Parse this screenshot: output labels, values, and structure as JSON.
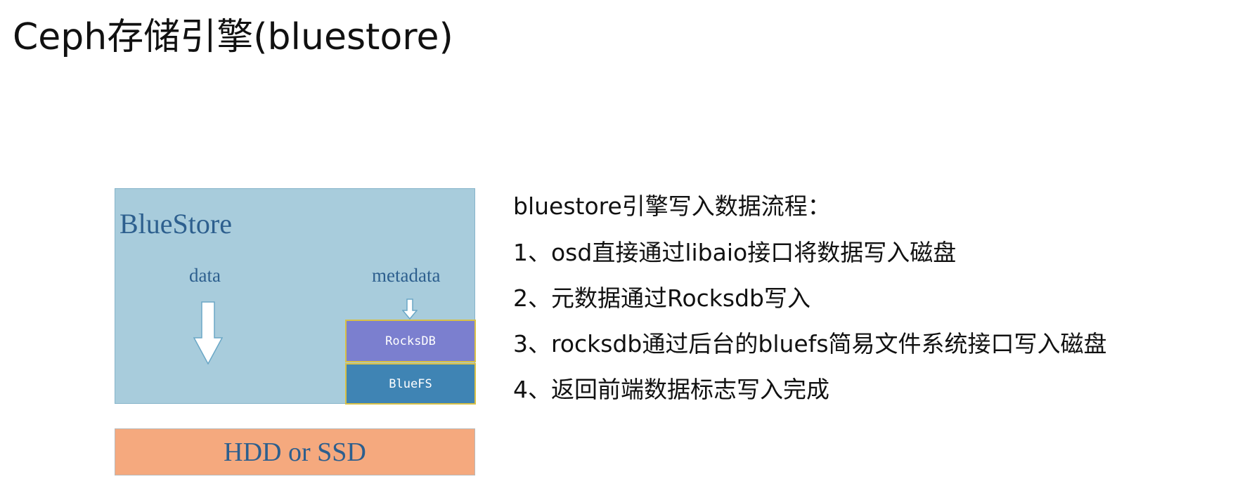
{
  "page": {
    "title": "Ceph存储引擎(bluestore)"
  },
  "diagram": {
    "bluestore_label": "BlueStore",
    "data_label": "data",
    "metadata_label": "metadata",
    "rocksdb_label": "RocksDB",
    "bluefs_label": "BlueFS",
    "disk_label": "HDD or SSD",
    "colors": {
      "bluestore_bg": "#a8ccdc",
      "label_text": "#2d5f8e",
      "rocksdb_bg": "#7b7fcf",
      "bluefs_bg": "#3f84b4",
      "inner_border": "#d8c046",
      "disk_bg": "#f5a97e"
    }
  },
  "steps": {
    "heading": "bluestore引擎写入数据流程：",
    "items": [
      "1、osd直接通过libaio接口将数据写入磁盘",
      "2、元数据通过Rocksdb写入",
      "3、rocksdb通过后台的bluefs简易文件系统接口写入磁盘",
      "4、返回前端数据标志写入完成"
    ]
  }
}
